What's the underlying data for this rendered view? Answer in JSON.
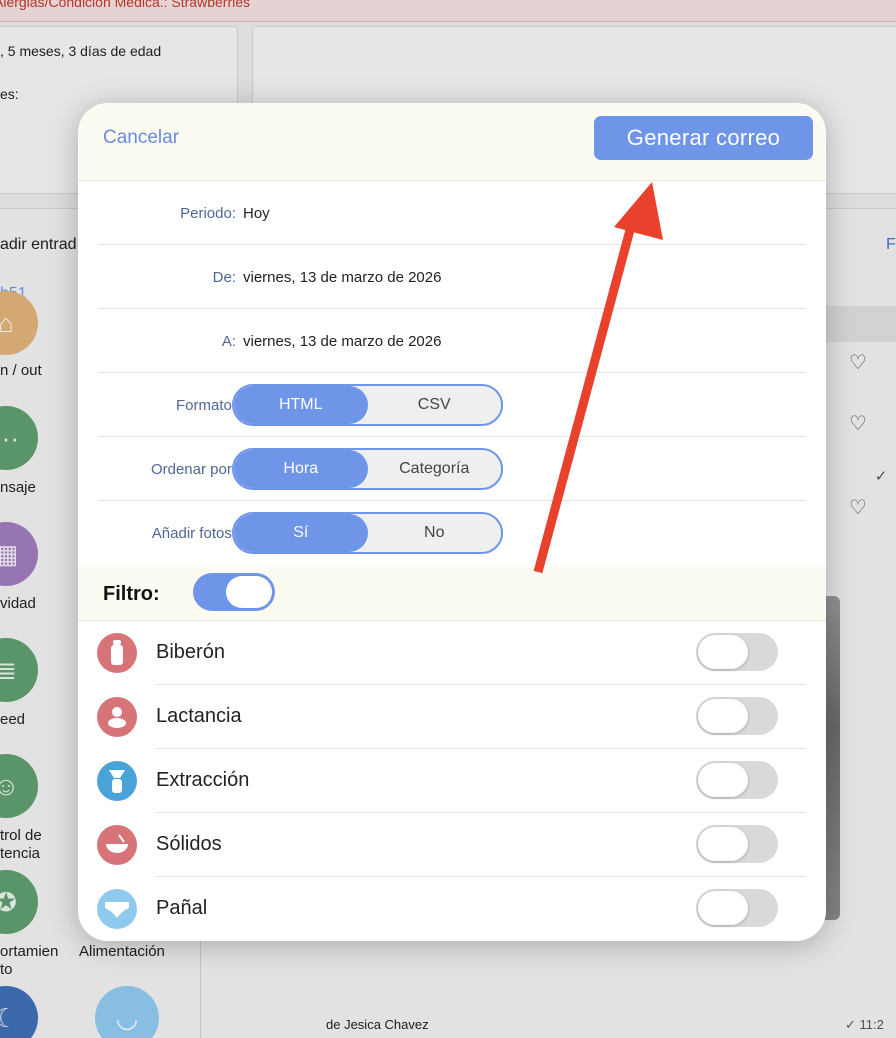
{
  "background": {
    "allergy_bar": "Alergias/Condición Médica.: Strawberries",
    "age_text": ", 5 meses, 3 días de edad",
    "notes_text": "es:",
    "add_entry": "adir entrad",
    "time_link": "h51",
    "filter_link": "F",
    "sidebar": [
      {
        "label": "n / out",
        "color": "#e0b27a",
        "icon": "home-icon"
      },
      {
        "label": "nsaje",
        "color": "#5e9e6e",
        "icon": "message-icon"
      },
      {
        "label": "vidad",
        "color": "#a07cbd",
        "icon": "blocks-icon"
      },
      {
        "label": "eed",
        "color": "#5e9e6e",
        "icon": "feed-icon"
      },
      {
        "label": "trol de\ntencia",
        "color": "#5e9e6e",
        "icon": "attendance-icon"
      },
      {
        "label": "ortamien\nto",
        "color": "#5e9e6e",
        "icon": "medal-icon"
      },
      {
        "label": "",
        "color": "#3f6fb6",
        "icon": "nap-icon"
      }
    ],
    "feeding_label": "Alimentación",
    "feed_author": "de Jesica Chavez",
    "feed_time": "✓ 11:2"
  },
  "modal": {
    "cancel_label": "Cancelar",
    "send_label": "Generar correo",
    "period": {
      "label": "Periodo:",
      "value": "Hoy"
    },
    "from": {
      "label": "De:",
      "value": "viernes, 13 de marzo de 2026"
    },
    "to": {
      "label": "A:",
      "value": "viernes, 13 de marzo de 2026"
    },
    "format": {
      "label": "Formato:",
      "options": [
        "HTML",
        "CSV"
      ],
      "selected": "HTML"
    },
    "sort": {
      "label": "Ordenar por:",
      "options": [
        "Hora",
        "Categoría"
      ],
      "selected": "Hora"
    },
    "photos": {
      "label": "Añadir fotos:",
      "options": [
        "Sí",
        "No"
      ],
      "selected": "Sí"
    },
    "filter": {
      "label": "Filtro:",
      "enabled": true
    },
    "filters": [
      {
        "label": "Biberón",
        "icon": "bottle-icon",
        "color": "#d9737a",
        "enabled": false
      },
      {
        "label": "Lactancia",
        "icon": "nursing-icon",
        "color": "#d9737a",
        "enabled": false
      },
      {
        "label": "Extracción",
        "icon": "pump-icon",
        "color": "#4aa3d6",
        "enabled": false
      },
      {
        "label": "Sólidos",
        "icon": "bowl-icon",
        "color": "#d9737a",
        "enabled": false
      },
      {
        "label": "Pañal",
        "icon": "diaper-icon",
        "color": "#8fc9ee",
        "enabled": false
      }
    ]
  },
  "colors": {
    "accent": "#6f95e9",
    "annotation_arrow": "#e8412c"
  }
}
